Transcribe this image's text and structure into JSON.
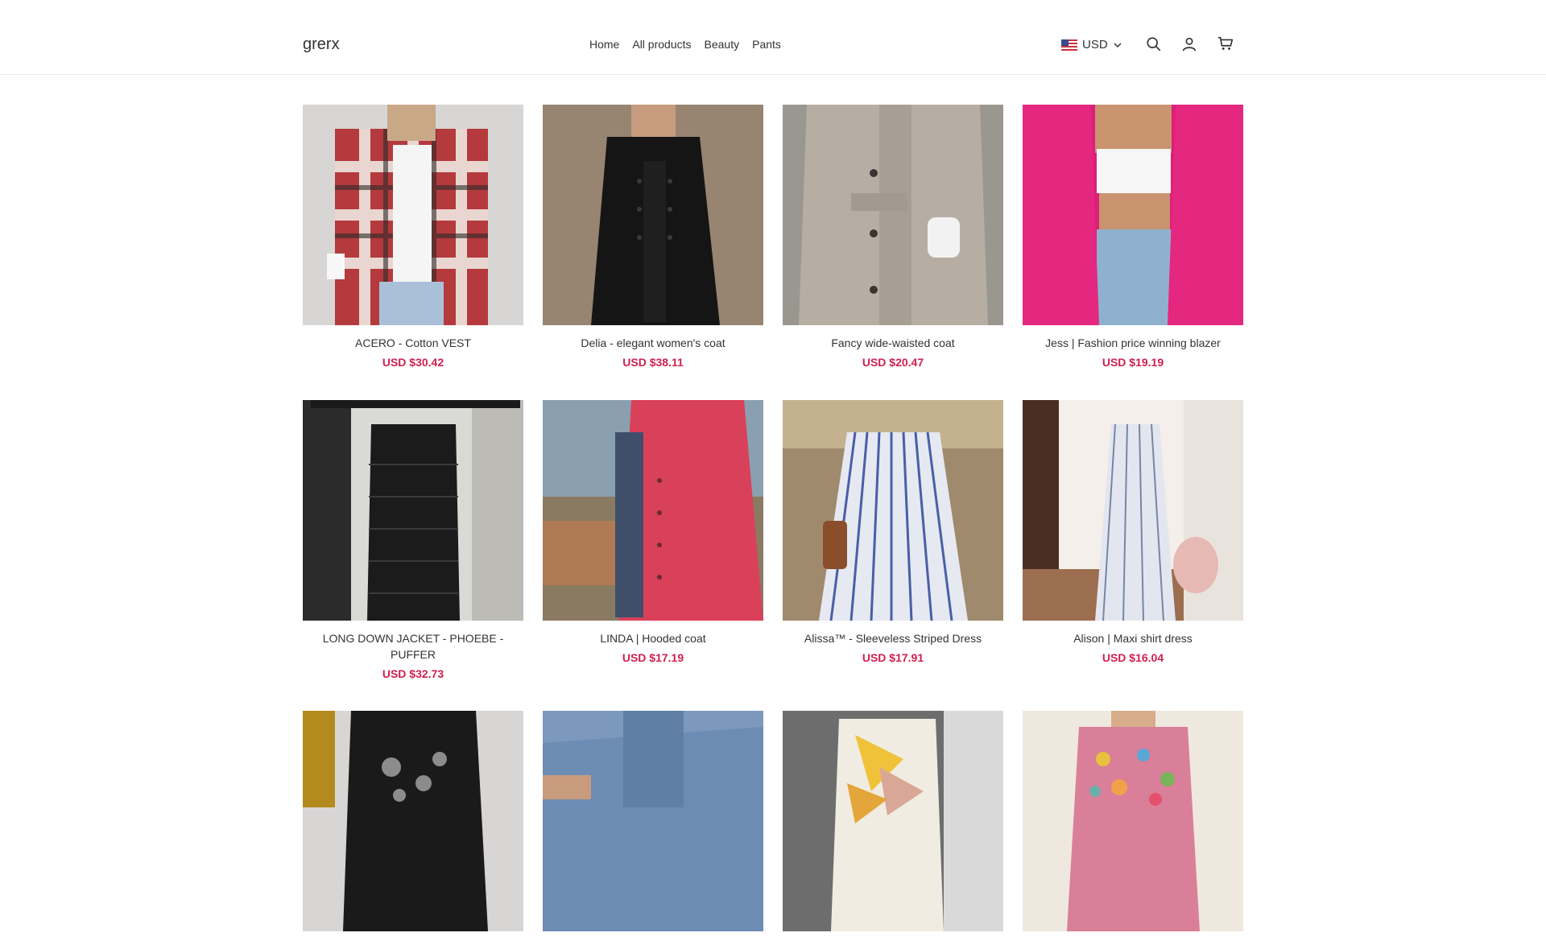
{
  "header": {
    "logo": "grerx",
    "nav": [
      "Home",
      "All products",
      "Beauty",
      "Pants"
    ],
    "currency": "USD",
    "icons": [
      "search-icon",
      "account-icon",
      "cart-icon"
    ]
  },
  "colors": {
    "price": "#d0204f",
    "border": "#ececec"
  },
  "products": [
    {
      "title": "ACERO - Cotton VEST",
      "price": "USD $30.42",
      "image": "plaid-jacket"
    },
    {
      "title": "Delia - elegant women's coat",
      "price": "USD $38.11",
      "image": "black-coat"
    },
    {
      "title": "Fancy wide-waisted coat",
      "price": "USD $20.47",
      "image": "beige-coat"
    },
    {
      "title": "Jess | Fashion price winning blazer",
      "price": "USD $19.19",
      "image": "pink-blazer"
    },
    {
      "title": "LONG DOWN JACKET - PHOEBE - PUFFER",
      "price": "USD $32.73",
      "image": "black-puffer"
    },
    {
      "title": "LINDA | Hooded coat",
      "price": "USD $17.19",
      "image": "red-coat"
    },
    {
      "title": "Alissa™ - Sleeveless Striped Dress",
      "price": "USD $17.91",
      "image": "striped-dress"
    },
    {
      "title": "Alison | Maxi shirt dress",
      "price": "USD $16.04",
      "image": "maxi-dress"
    },
    {
      "title": "",
      "price": "",
      "image": "black-dotted-dress"
    },
    {
      "title": "",
      "price": "",
      "image": "denim-shirt"
    },
    {
      "title": "",
      "price": "",
      "image": "print-top"
    },
    {
      "title": "",
      "price": "",
      "image": "floral-blouse"
    }
  ]
}
